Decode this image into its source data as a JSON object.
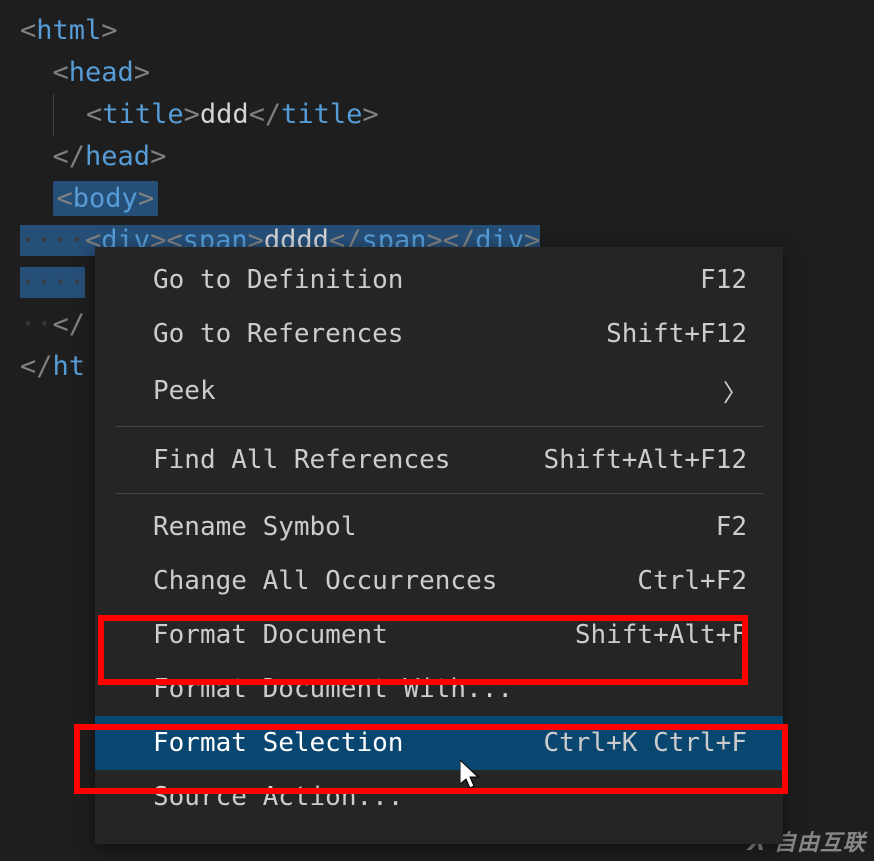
{
  "code": {
    "line1_open": "<",
    "line1_tag": "html",
    "line1_close": ">",
    "line2_open": "<",
    "line2_tag": "head",
    "line2_close": ">",
    "line3_open": "<",
    "line3_tag": "title",
    "line3_close1": ">",
    "line3_text": "ddd",
    "line3_open2": "</",
    "line3_close2": ">",
    "line4_open": "</",
    "line4_tag": "head",
    "line4_close": ">",
    "line5_open": "<",
    "line5_tag": "body",
    "line5_close": ">",
    "line6_divopen": "<",
    "line6_div": "div",
    "line6_divclose1": ">",
    "line6_spanopen": "<",
    "line6_span": "span",
    "line6_spanclose1": ">",
    "line6_text": "dddd",
    "line6_spanopen2": "</",
    "line6_spanclose2": ">",
    "line6_divopen2": "</",
    "line6_divclose2": ">",
    "line7_open": "</",
    "line8_open": "</",
    "line8_tag": "ht"
  },
  "menu": {
    "items": [
      {
        "label": "Go to Definition",
        "shortcut": "F12",
        "submenu": false
      },
      {
        "label": "Go to References",
        "shortcut": "Shift+F12",
        "submenu": false
      },
      {
        "label": "Peek",
        "shortcut": "",
        "submenu": true
      }
    ],
    "group2": [
      {
        "label": "Find All References",
        "shortcut": "Shift+Alt+F12",
        "submenu": false
      }
    ],
    "group3": [
      {
        "label": "Rename Symbol",
        "shortcut": "F2",
        "submenu": false
      },
      {
        "label": "Change All Occurrences",
        "shortcut": "Ctrl+F2",
        "submenu": false
      },
      {
        "label": "Format Document",
        "shortcut": "Shift+Alt+F",
        "submenu": false
      },
      {
        "label": "Format Document With...",
        "shortcut": "",
        "submenu": false
      },
      {
        "label": "Format Selection",
        "shortcut": "Ctrl+K Ctrl+F",
        "submenu": false,
        "hovered": true
      },
      {
        "label": "Source Action...",
        "shortcut": "",
        "submenu": false
      }
    ]
  },
  "watermark": "自由互联"
}
